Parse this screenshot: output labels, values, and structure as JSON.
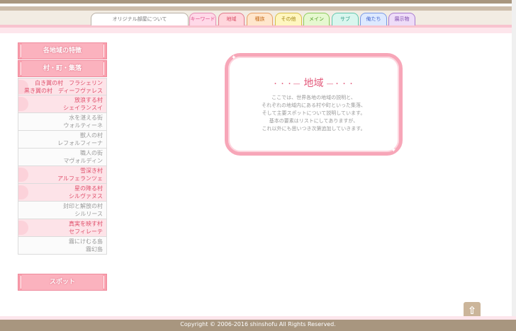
{
  "tabs": [
    {
      "label": "オリジナル部屋について"
    },
    {
      "label": "キーワード"
    },
    {
      "label": "地域"
    },
    {
      "label": "種族"
    },
    {
      "label": "その他"
    },
    {
      "label": "メイン"
    },
    {
      "label": "サブ"
    },
    {
      "label": "俺たち"
    },
    {
      "label": "展示物"
    }
  ],
  "sidebar": {
    "heading_features": "各地域の特徴",
    "heading_settlements": "村・町・集落",
    "items": [
      {
        "line1": "白き翼の村　フラシェリン",
        "line2": "黒き翼の村　ディーフヴァレス",
        "style": "pink"
      },
      {
        "line1": "放浪する村",
        "line2": "シェイランスイ",
        "style": "pink"
      },
      {
        "line1": "水を湛える街",
        "line2": "ウォルティーネ",
        "style": "gray"
      },
      {
        "line1": "獣人の村",
        "line2": "レフォルフィーナ",
        "style": "gray"
      },
      {
        "line1": "職人の街",
        "line2": "マヴォルディン",
        "style": "gray"
      },
      {
        "line1": "雪深き村",
        "line2": "アルフェランツェ",
        "style": "pink"
      },
      {
        "line1": "星の降る村",
        "line2": "シルヴァヌス",
        "style": "pink"
      },
      {
        "line1": "封印と解放の村",
        "line2": "シルリース",
        "style": "gray"
      },
      {
        "line1": "真実を映す村",
        "line2": "セフィレーテ",
        "style": "pink"
      },
      {
        "line1": "霧にけむる島",
        "line2": "霧幻島",
        "style": "gray"
      }
    ],
    "heading_spots": "スポット"
  },
  "card": {
    "title": "地域",
    "title_dots_left": "・・・―",
    "title_dots_right": "―・・・",
    "lines": [
      "ここでは、世界各地の地域の説明と、",
      "それぞれの地域内にある村や町といった集落、",
      "そして主要スポットについて説明しています。",
      "基本の要素はリストにしてありますが、",
      "これ以外にも思いつき次第追加していきます。"
    ]
  },
  "back_to_top": {
    "icon": "up-arrow-icon",
    "glyph": "⇧"
  },
  "footer": {
    "copyright": "Copyright © 2006-2016 shinshofu All Rights Reserved."
  }
}
